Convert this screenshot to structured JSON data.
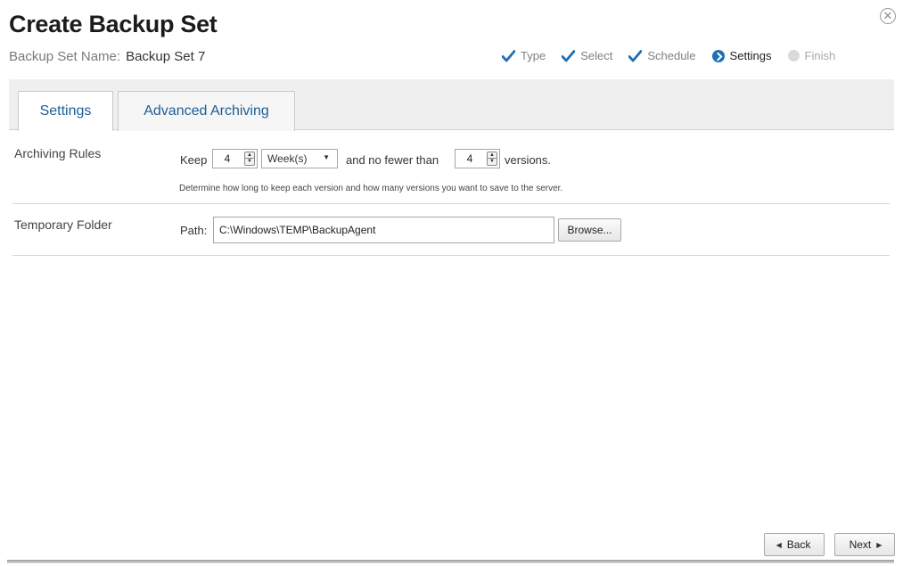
{
  "title": "Create Backup Set",
  "close_glyph": "✕",
  "backup_set": {
    "label": "Backup Set Name:",
    "value": "Backup Set 7"
  },
  "steps": [
    {
      "label": "Type",
      "state": "done",
      "icon": "check-icon"
    },
    {
      "label": "Select",
      "state": "done",
      "icon": "check-icon"
    },
    {
      "label": "Schedule",
      "state": "done",
      "icon": "check-icon"
    },
    {
      "label": "Settings",
      "state": "current",
      "icon": "arrow-circle-icon"
    },
    {
      "label": "Finish",
      "state": "pending",
      "icon": "circle-icon"
    }
  ],
  "tabs": [
    {
      "label": "Settings",
      "active": true
    },
    {
      "label": "Advanced Archiving",
      "active": false
    }
  ],
  "archiving": {
    "label": "Archiving Rules",
    "keep_label": "Keep",
    "keep_value": "4",
    "unit_value": "Week(s)",
    "fewer_label": "and no fewer than",
    "versions_value": "4",
    "versions_label": "versions.",
    "hint": "Determine how long to keep each version and how many versions you want to save to the server."
  },
  "temp_folder": {
    "label": "Temporary Folder",
    "path_label": "Path:",
    "path_value": "C:\\Windows\\TEMP\\BackupAgent",
    "browse_label": "Browse..."
  },
  "nav": {
    "back_label": "Back",
    "next_label": "Next"
  },
  "colors": {
    "accent": "#1f6eb6",
    "tab_text": "#1d5e95",
    "tabbar_bg": "#efefef"
  }
}
